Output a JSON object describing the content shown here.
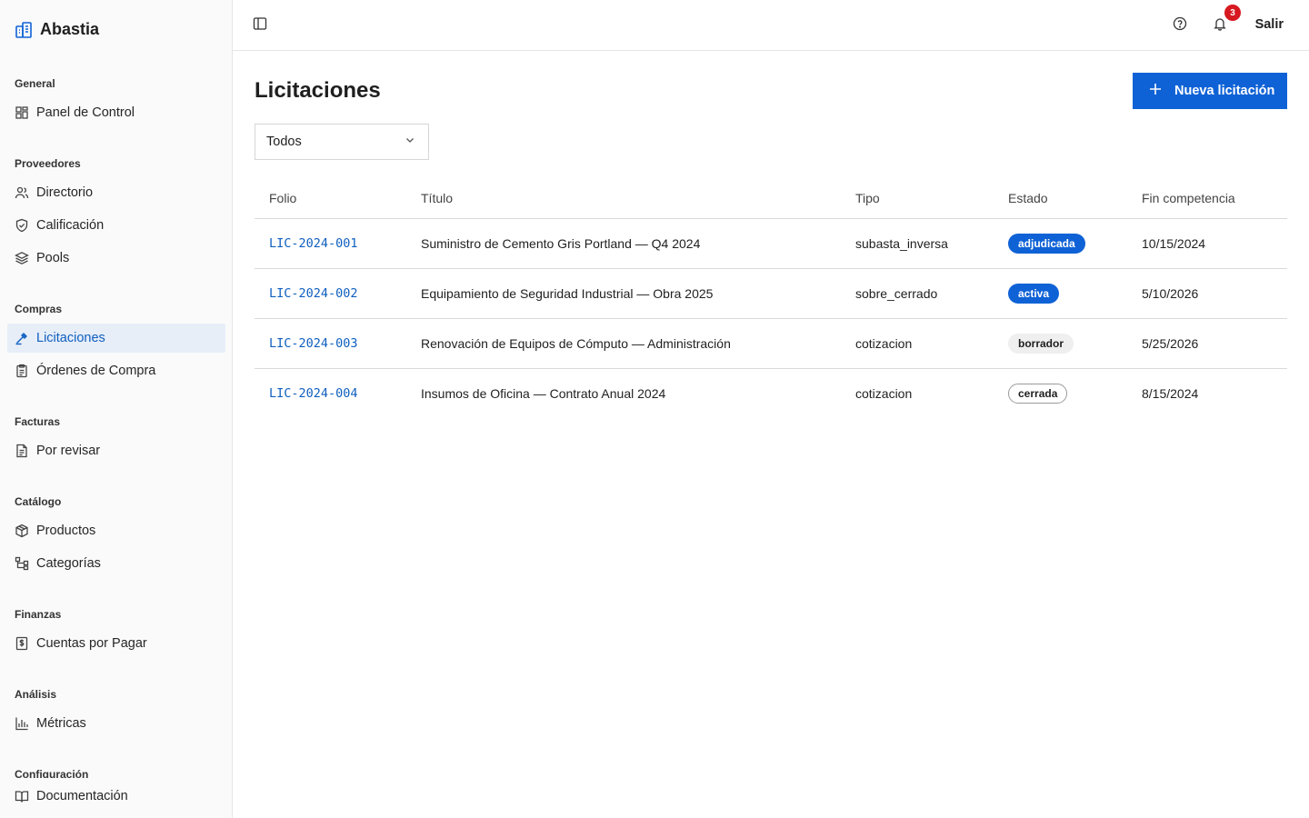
{
  "app": {
    "name": "Abastia"
  },
  "sidebar": {
    "sections": [
      {
        "title": "General",
        "items": [
          {
            "label": "Panel de Control",
            "icon": "dashboard-icon"
          }
        ]
      },
      {
        "title": "Proveedores",
        "items": [
          {
            "label": "Directorio",
            "icon": "users-icon"
          },
          {
            "label": "Calificación",
            "icon": "shield-check-icon"
          },
          {
            "label": "Pools",
            "icon": "layers-icon"
          }
        ]
      },
      {
        "title": "Compras",
        "items": [
          {
            "label": "Licitaciones",
            "icon": "gavel-icon",
            "active": true
          },
          {
            "label": "Órdenes de Compra",
            "icon": "clipboard-icon"
          }
        ]
      },
      {
        "title": "Facturas",
        "items": [
          {
            "label": "Por revisar",
            "icon": "document-icon"
          }
        ]
      },
      {
        "title": "Catálogo",
        "items": [
          {
            "label": "Productos",
            "icon": "package-icon"
          },
          {
            "label": "Categorías",
            "icon": "tree-icon"
          }
        ]
      },
      {
        "title": "Finanzas",
        "items": [
          {
            "label": "Cuentas por Pagar",
            "icon": "receipt-dollar-icon"
          }
        ]
      },
      {
        "title": "Análisis",
        "items": [
          {
            "label": "Métricas",
            "icon": "bar-chart-icon"
          }
        ]
      },
      {
        "title": "Configuración",
        "items": []
      }
    ],
    "bottom_item": {
      "label": "Documentación",
      "icon": "book-icon"
    }
  },
  "topbar": {
    "notifications_count": "3",
    "logout_label": "Salir"
  },
  "main": {
    "title": "Licitaciones",
    "new_button_label": "Nueva licitación",
    "filter": {
      "selected": "Todos"
    },
    "table": {
      "headers": {
        "folio": "Folio",
        "titulo": "Título",
        "tipo": "Tipo",
        "estado": "Estado",
        "fin": "Fin competencia"
      },
      "rows": [
        {
          "folio": "LIC-2024-001",
          "titulo": "Suministro de Cemento Gris Portland — Q4 2024",
          "tipo": "subasta_inversa",
          "estado": "adjudicada",
          "fin": "10/15/2024"
        },
        {
          "folio": "LIC-2024-002",
          "titulo": "Equipamiento de Seguridad Industrial — Obra 2025",
          "tipo": "sobre_cerrado",
          "estado": "activa",
          "fin": "5/10/2026"
        },
        {
          "folio": "LIC-2024-003",
          "titulo": "Renovación de Equipos de Cómputo — Administración",
          "tipo": "cotizacion",
          "estado": "borrador",
          "fin": "5/25/2026"
        },
        {
          "folio": "LIC-2024-004",
          "titulo": "Insumos de Oficina — Contrato Anual 2024",
          "tipo": "cotizacion",
          "estado": "cerrada",
          "fin": "8/15/2024"
        }
      ]
    }
  },
  "colors": {
    "accent": "#0f62d6",
    "active_nav_bg": "#e7eef8",
    "badge_red": "#d71920",
    "link_blue": "#0f5fbf"
  }
}
